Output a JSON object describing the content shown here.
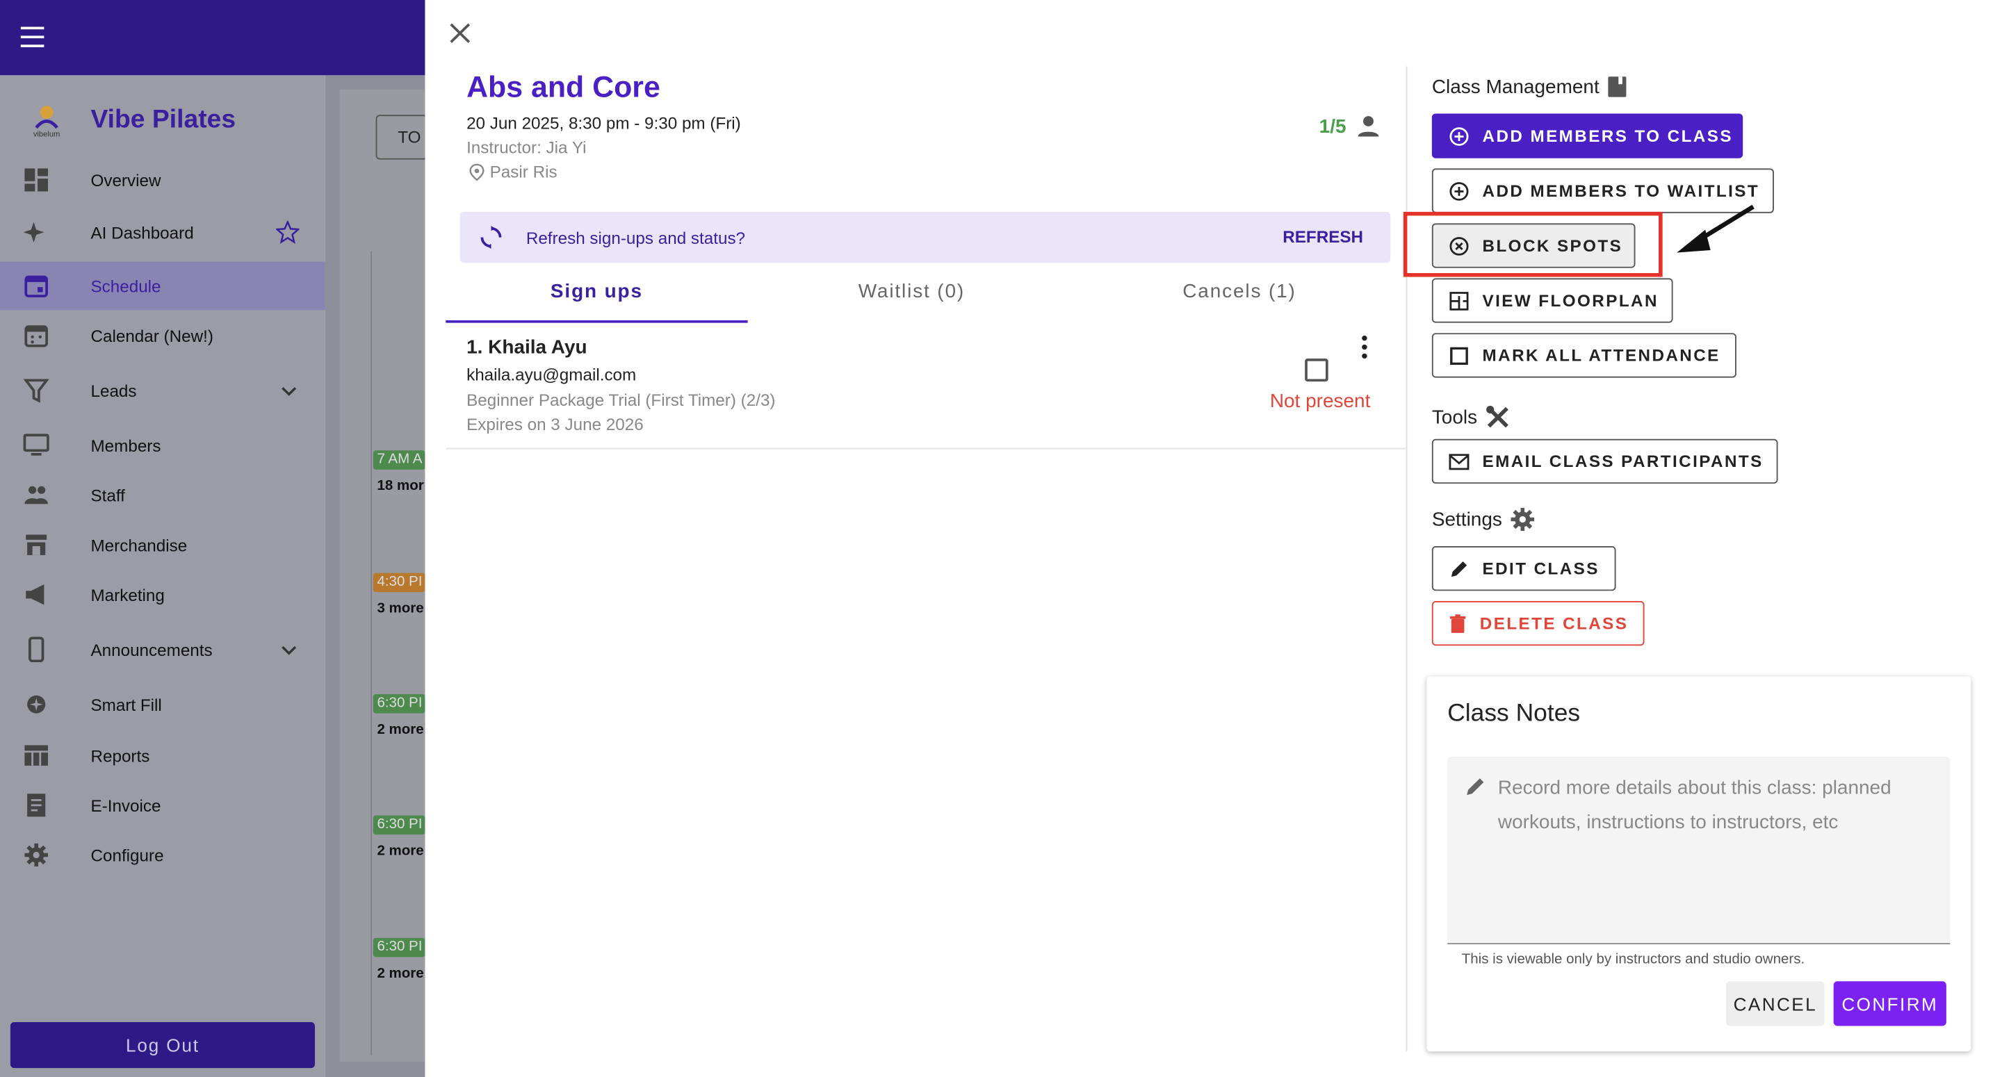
{
  "app": {
    "brand_name": "Vibe Pilates",
    "logo_text": "vibelum",
    "logout_label": "Log Out"
  },
  "sidebar": {
    "items": [
      {
        "label": "Overview",
        "icon": "dashboard-icon"
      },
      {
        "label": "AI Dashboard",
        "icon": "sparkle-icon"
      },
      {
        "label": "Schedule",
        "icon": "calendar-icon",
        "active": true
      },
      {
        "label": "Calendar (New!)",
        "icon": "calendar-grid-icon"
      },
      {
        "label": "Leads",
        "icon": "filter-icon"
      },
      {
        "label": "Members",
        "icon": "members-icon"
      },
      {
        "label": "Staff",
        "icon": "people-icon"
      },
      {
        "label": "Merchandise",
        "icon": "store-icon"
      },
      {
        "label": "Marketing",
        "icon": "megaphone-icon"
      },
      {
        "label": "Announcements",
        "icon": "phone-icon"
      },
      {
        "label": "Smart Fill",
        "icon": "smart-fill-icon"
      },
      {
        "label": "Reports",
        "icon": "table-icon"
      },
      {
        "label": "E-Invoice",
        "icon": "invoice-icon"
      },
      {
        "label": "Configure",
        "icon": "gear-icon"
      }
    ]
  },
  "background": {
    "today_button": "TO",
    "chips": [
      {
        "time": "7 AM A",
        "more": "18 mor",
        "color": "#4e8a4e"
      },
      {
        "time": "4:30 PI",
        "more": "3 more",
        "color": "#b8792f"
      },
      {
        "time": "6:30 PI",
        "more": "2 more",
        "color": "#4e8a4e"
      },
      {
        "time": "6:30 PI",
        "more": "2 more",
        "color": "#4e8a4e"
      },
      {
        "time": "6:30 PI",
        "more": "2 more",
        "color": "#4e8a4e"
      }
    ]
  },
  "class_info": {
    "title": "Abs and Core",
    "datetime": "20 Jun 2025, 8:30 pm - 9:30 pm (Fri)",
    "instructor": "Instructor: Jia Yi",
    "location": "Pasir Ris",
    "capacity": "1/5"
  },
  "refresh": {
    "message": "Refresh sign-ups and status?",
    "button": "REFRESH"
  },
  "tabs": [
    {
      "label": "Sign ups",
      "active": true
    },
    {
      "label": "Waitlist (0)"
    },
    {
      "label": "Cancels (1)"
    }
  ],
  "signups": [
    {
      "name": "1. Khaila Ayu",
      "email": "khaila.ayu@gmail.com",
      "package": "Beginner Package Trial (First Timer) (2/3)",
      "expiry": "Expires on 3 June 2026",
      "status": "Not present"
    }
  ],
  "management": {
    "title": "Class Management",
    "add_members": "ADD MEMBERS TO CLASS",
    "add_waitlist": "ADD MEMBERS TO WAITLIST",
    "block_spots": "BLOCK SPOTS",
    "view_floorplan": "VIEW FLOORPLAN",
    "mark_attendance": "MARK ALL ATTENDANCE"
  },
  "tools": {
    "title": "Tools",
    "email": "EMAIL CLASS PARTICIPANTS"
  },
  "settings": {
    "title": "Settings",
    "edit": "EDIT CLASS",
    "delete": "DELETE CLASS"
  },
  "notes": {
    "title": "Class Notes",
    "placeholder": "Record more details about this class: planned workouts, instructions to instructors, etc",
    "help": "This is viewable only by instructors and studio owners.",
    "cancel": "CANCEL",
    "confirm": "CONFIRM"
  },
  "colors": {
    "brand": "#4a1fc4",
    "danger": "#e0453a",
    "present": "#4aa04a",
    "highlight": "#e5322a"
  }
}
